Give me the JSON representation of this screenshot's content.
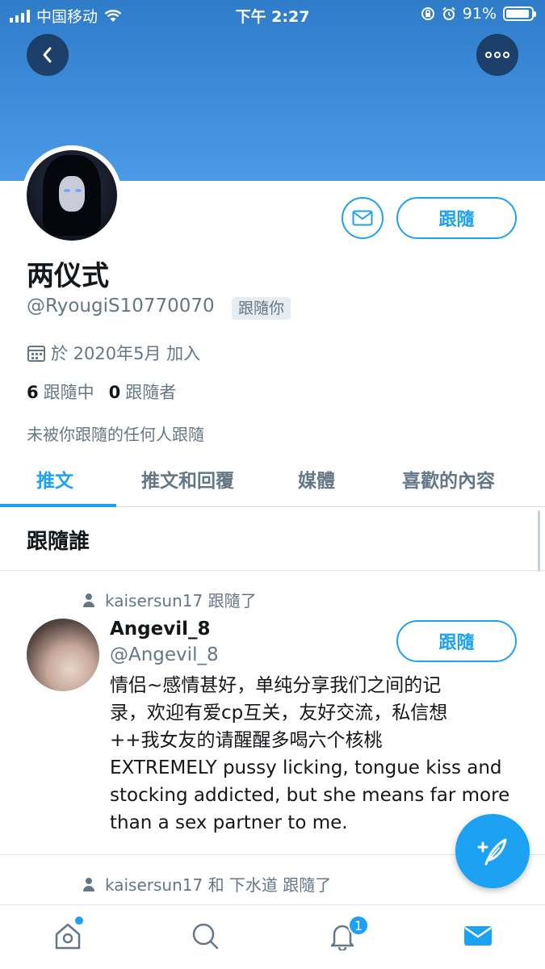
{
  "status_bar": {
    "carrier": "中国移动",
    "time": "下午 2:27",
    "battery": "91%"
  },
  "profile": {
    "name": "两仪式",
    "handle": "@RyougiS10770070",
    "follows_you_label": "跟隨你",
    "joined": "於 2020年5月 加入",
    "following_count": "6",
    "following_label": "跟隨中",
    "followers_count": "0",
    "followers_label": "跟隨者",
    "not_followed_by": "未被你跟隨的任何人跟隨",
    "follow_label": "跟隨"
  },
  "tabs": [
    {
      "label": "推文",
      "active": true
    },
    {
      "label": "推文和回覆",
      "active": false
    },
    {
      "label": "媒體",
      "active": false
    },
    {
      "label": "喜歡的內容",
      "active": false
    }
  ],
  "who_to_follow": {
    "title": "跟隨誰",
    "items": [
      {
        "context": "kaisersun17 跟隨了",
        "name": "Angevil_8",
        "handle": "@Angevil_8",
        "follow_label": "跟隨",
        "bio_lines": [
          "情侣~感情甚好，单纯分享我们之间的记",
          "录，欢迎有爱cp互关，友好交流，私信想",
          "++我女友的请醒醒多喝六个核桃",
          "EXTREMELY pussy licking, tongue kiss and",
          "stocking addicted, but she means far more",
          "than a sex partner to me."
        ]
      },
      {
        "context": "kaisersun17 和 下水道 跟隨了"
      }
    ]
  },
  "bottom_nav": {
    "notifications_badge": "1"
  },
  "colors": {
    "accent": "#1da1f2",
    "banner": "#3a8ad8",
    "muted": "#657786"
  }
}
